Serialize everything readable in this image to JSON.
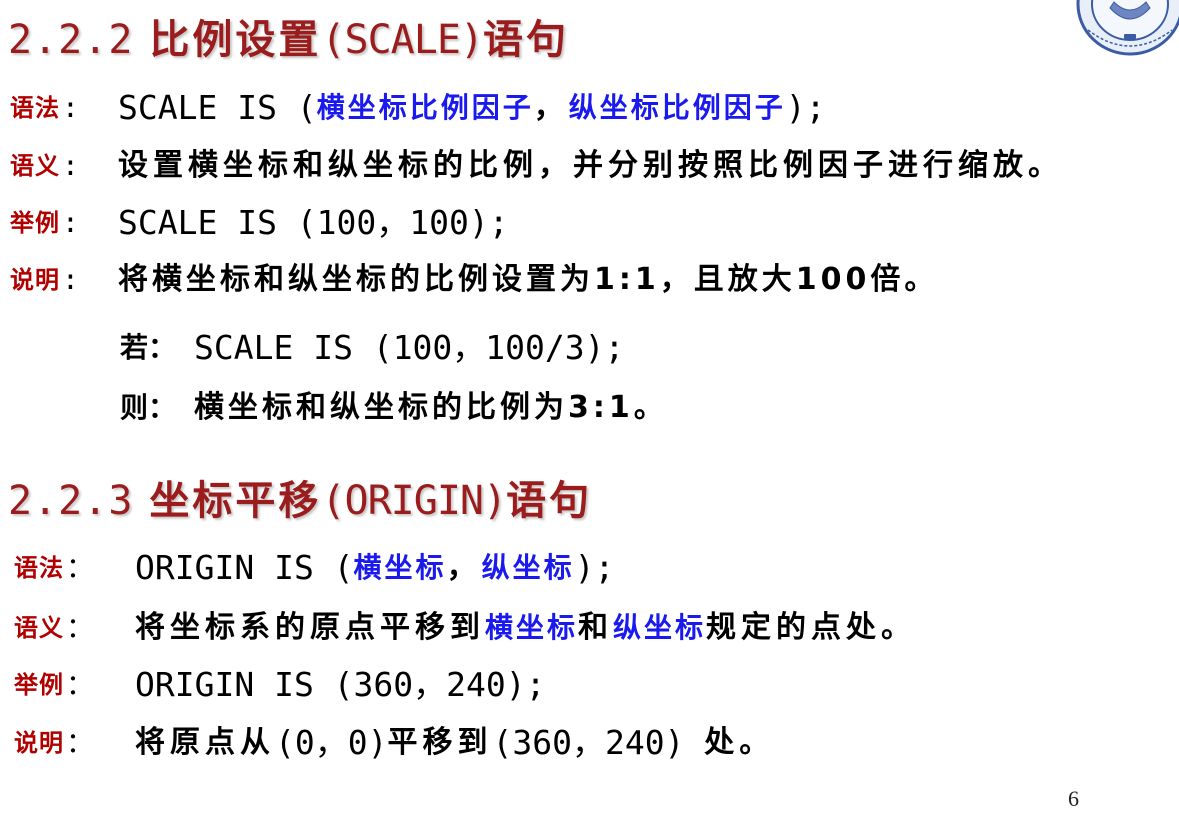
{
  "s1": {
    "title": {
      "number": "2.2.2",
      "name": "比例设置",
      "keyword": "(SCALE)",
      "suffix": "语句"
    },
    "syntax": {
      "label": "语法",
      "colon": ":",
      "pre": "SCALE IS (",
      "arg1": "横坐标比例因子",
      "sep": "，",
      "arg2": "纵坐标比例因子",
      "post": ");"
    },
    "semantics": {
      "label": "语义",
      "colon": ":",
      "text": "设置横坐标和纵坐标的比例，并分别按照比例因子进行缩放。"
    },
    "example": {
      "label": "举例",
      "colon": ":",
      "code": "SCALE IS (100，100);"
    },
    "note": {
      "label": "说明",
      "colon": ":",
      "text": "将横坐标和纵坐标的比例设置为1:1，且放大100倍。"
    },
    "if_line": {
      "prefix": "若：",
      "code": "SCALE IS (100，100/3);"
    },
    "then_line": {
      "prefix": "则：",
      "text": "横坐标和纵坐标的比例为3:1。"
    }
  },
  "s2": {
    "title": {
      "number": "2.2.3",
      "name": "坐标平移",
      "keyword": "(ORIGIN)",
      "suffix": "语句"
    },
    "syntax": {
      "label": "语法",
      "colon": "：",
      "pre": "ORIGIN IS (",
      "arg1": "横坐标",
      "sep": "，",
      "arg2": "纵坐标",
      "post": ");"
    },
    "semantics": {
      "label": "语义",
      "colon": "：",
      "pre": "将坐标系的原点平移到",
      "word1": "横坐标",
      "mid": "和",
      "word2": "纵坐标",
      "post": "规定的点处。"
    },
    "example": {
      "label": "举例",
      "colon": "：",
      "code": "ORIGIN IS (360，240);"
    },
    "note": {
      "label": "说明",
      "colon": "：",
      "text_a": "将原点从",
      "code_a": "(0，0)",
      "text_b": "平移到",
      "code_b": "(360，240) ",
      "text_c": "处。"
    }
  },
  "page_number": "6",
  "colors": {
    "title": "#9a1c1c",
    "label": "#b00000",
    "highlight": "#1a1aee",
    "seal": "#3b5ba5"
  },
  "logo": {
    "icon": "university-seal-icon"
  }
}
